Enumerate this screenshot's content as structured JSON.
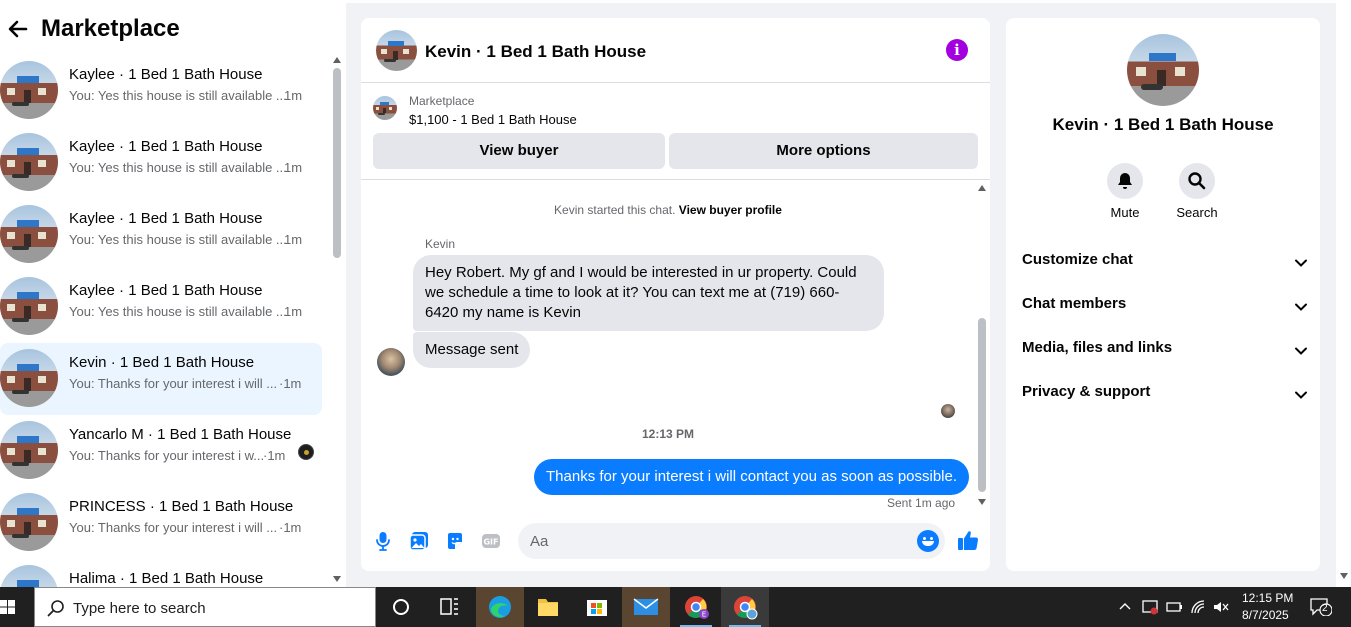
{
  "left_panel": {
    "title": "Marketplace",
    "conversations": [
      {
        "name": "Kaylee · 1 Bed 1 Bath House",
        "snippet": "You: Yes this house is still available ...",
        "time": "1m"
      },
      {
        "name": "Kaylee · 1 Bed 1 Bath House",
        "snippet": "You: Yes this house is still available ...",
        "time": "1m"
      },
      {
        "name": "Kaylee · 1 Bed 1 Bath House",
        "snippet": "You: Yes this house is still available ...",
        "time": "1m"
      },
      {
        "name": "Kaylee · 1 Bed 1 Bath House",
        "snippet": "You: Yes this house is still available ...",
        "time": "1m"
      },
      {
        "name": "Kevin · 1 Bed 1 Bath House",
        "snippet": "You: Thanks for your interest i will ...",
        "time": "·1m",
        "active": true
      },
      {
        "name": "Yancarlo M · 1 Bed 1 Bath House",
        "snippet": "You: Thanks for your interest i w...",
        "time": "·1m"
      },
      {
        "name": "PRINCESS · 1 Bed 1 Bath House",
        "snippet": "You: Thanks for your interest i will ...",
        "time": "·1m"
      },
      {
        "name": "Halima · 1 Bed 1 Bath House",
        "snippet": "",
        "time": ""
      }
    ]
  },
  "chat": {
    "title": "Kevin · 1 Bed 1 Bath House",
    "listing": {
      "category": "Marketplace",
      "price_title": "$1,100 - 1 Bed 1 Bath House",
      "view_buyer_label": "View buyer",
      "more_options_label": "More options"
    },
    "system_line": {
      "text": "Kevin started this chat. ",
      "link": "View buyer profile"
    },
    "sender_name": "Kevin",
    "incoming": [
      "Hey Robert. My gf and I would be interested in ur property. Could we schedule a time to look at it? You can text me at (719) 660-6420 my name is Kevin",
      "Message sent"
    ],
    "timestamp": "12:13 PM",
    "outgoing": "Thanks for your interest i will contact you as soon as possible.",
    "sent_status": "Sent 1m ago",
    "composer_placeholder": "Aa"
  },
  "right_panel": {
    "title": "Kevin · 1 Bed 1 Bath House",
    "actions": [
      {
        "label": "Mute",
        "icon": "bell-icon"
      },
      {
        "label": "Search",
        "icon": "search-icon"
      }
    ],
    "sections": [
      "Customize chat",
      "Chat members",
      "Media, files and links",
      "Privacy & support"
    ]
  },
  "taskbar": {
    "search_placeholder": "Type here to search",
    "time": "12:15 PM",
    "date": "8/7/2025",
    "notification_count": "2"
  },
  "colors": {
    "accent": "#0a7cff",
    "info": "#a200e0",
    "active_row": "#ebf5ff"
  }
}
